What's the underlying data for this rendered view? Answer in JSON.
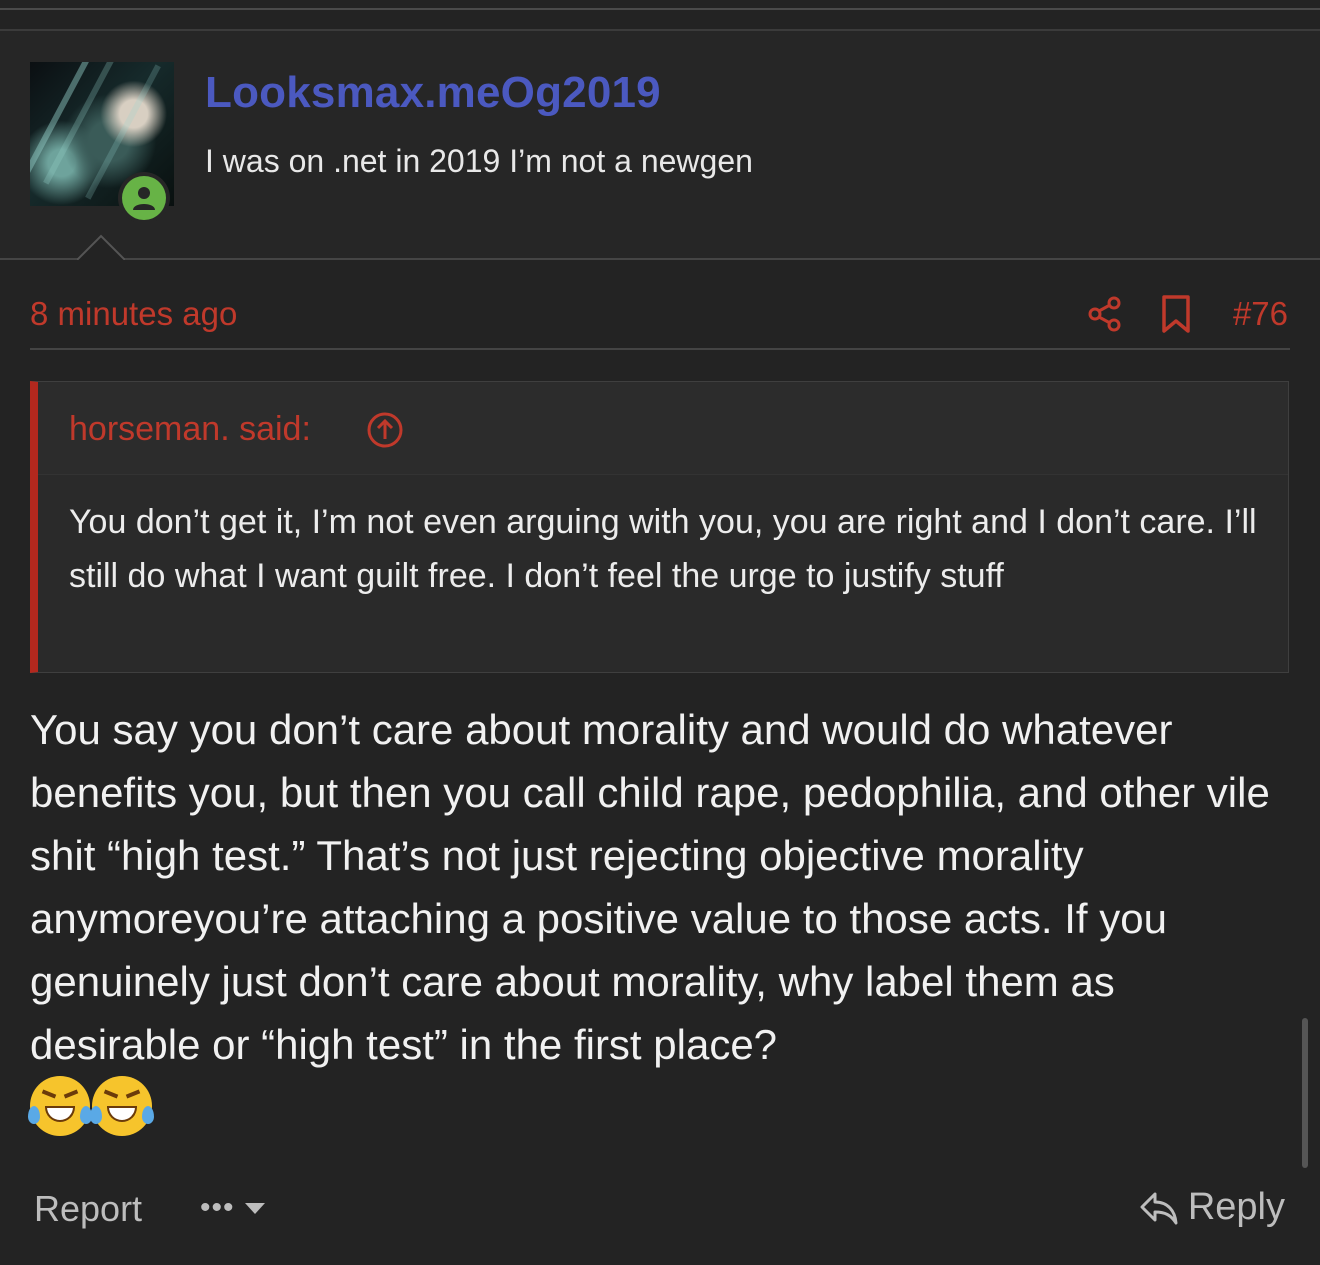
{
  "post": {
    "author": {
      "username": "Looksmax.meOg2019",
      "user_title": "I was on .net in 2019 I’m not a newgen",
      "username_color": "#4b59c0",
      "avatar_icon": "anime-avatar-image",
      "status_icon": "online-user-icon",
      "status_color": "#67b346"
    },
    "time": "8 minutes ago",
    "actions": {
      "share_icon": "share-icon",
      "bookmark_icon": "bookmark-icon",
      "post_number": "#76"
    },
    "quote": {
      "author_label": "horseman. said:",
      "jump_icon": "arrow-up-circle-icon",
      "text": "You don’t get it, I’m not even arguing with you, you are right and I don’t care. I’ll still do what I want guilt free. I don’t feel the urge to justify stuff"
    },
    "body": "You say you don’t care about morality and would do whatever benefits you, but then you call child rape, pedophilia, and other vile shit “high test.” That’s not just rejecting objective morality anymoreyou’re attaching a positive value to those acts. If you genuinely just don’t care about morality, why label them as desirable or “high test” in the first place?",
    "emojis": [
      "laughing-crying-emoji",
      "laughing-crying-emoji"
    ],
    "footer": {
      "report_label": "Report",
      "more_label": "•••",
      "more_icon": "chevron-down-icon",
      "reply_icon": "reply-arrow-icon",
      "reply_label": "Reply"
    }
  },
  "theme": {
    "background": "#232323",
    "accent": "#c0392b",
    "quote_border": "#b3281e"
  }
}
